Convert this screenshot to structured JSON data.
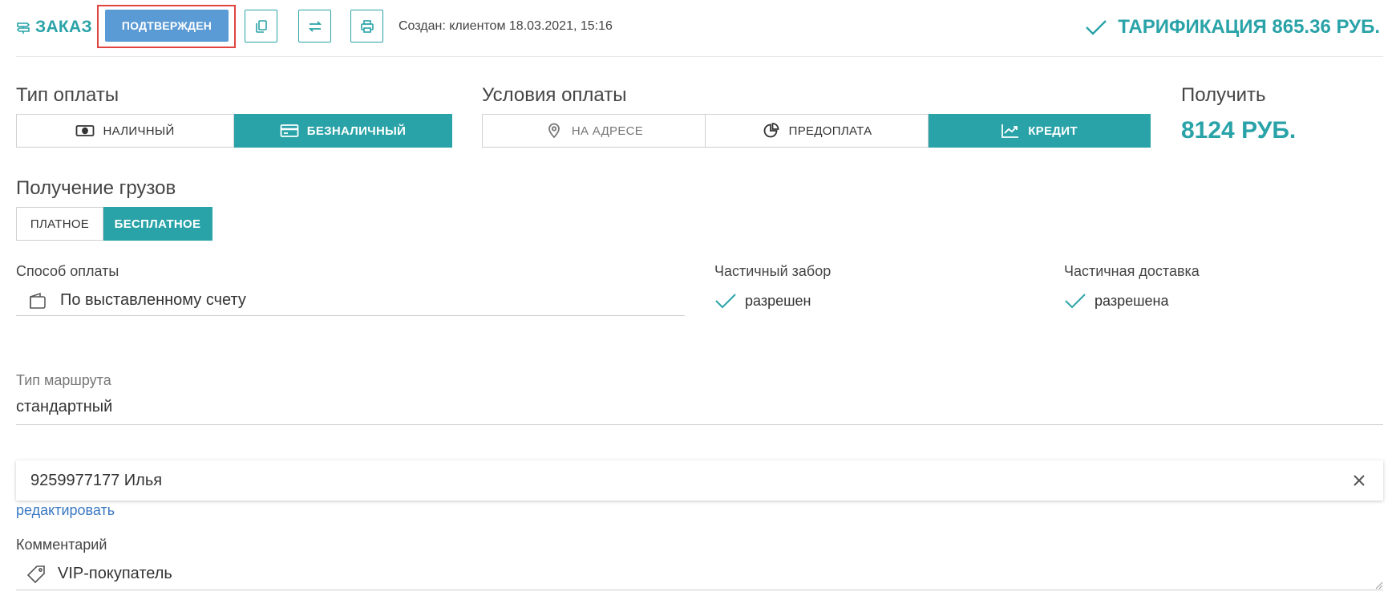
{
  "header": {
    "order_label": "ЗАКАЗ",
    "status_label": "ПОДТВЕРЖДЕН",
    "created_text": "Создан: клиентом 18.03.2021, 15:16",
    "tariff_text": "ТАРИФИКАЦИЯ 865.36 РУБ.",
    "actions": [
      {
        "icon": "copy-icon"
      },
      {
        "icon": "swap-icon"
      },
      {
        "icon": "print-icon"
      }
    ]
  },
  "payment_type": {
    "label": "Тип оплаты",
    "options": [
      {
        "label": "НАЛИЧНЫЙ",
        "icon": "cash-icon",
        "active": false
      },
      {
        "label": "БЕЗНАЛИЧНЫЙ",
        "icon": "card-icon",
        "active": true
      }
    ]
  },
  "payment_terms": {
    "label": "Условия оплаты",
    "options": [
      {
        "label": "НА АДРЕСЕ",
        "icon": "location-pin-icon",
        "active": false,
        "muted": true
      },
      {
        "label": "ПРЕДОПЛАТА",
        "icon": "pie-chart-icon",
        "active": false,
        "muted": false
      },
      {
        "label": "КРЕДИТ",
        "icon": "trend-chart-icon",
        "active": true,
        "muted": false
      }
    ]
  },
  "receive": {
    "label": "Получить",
    "amount": "8124 РУБ."
  },
  "cargo_receipt": {
    "label": "Получение грузов",
    "options": [
      {
        "label": "ПЛАТНОЕ",
        "active": false
      },
      {
        "label": "БЕСПЛАТНОЕ",
        "active": true
      }
    ]
  },
  "payment_method": {
    "label": "Способ оплаты",
    "value": "По выставленному счету",
    "icon": "wallet-icon"
  },
  "partial_pickup": {
    "label": "Частичный забор",
    "value": "разрешен"
  },
  "partial_delivery": {
    "label": "Частичная доставка",
    "value": "разрешена"
  },
  "route_type": {
    "label": "Тип маршрута",
    "value": "стандартный"
  },
  "contact": {
    "value": "9259977177 Илья",
    "edit_label": "редактировать"
  },
  "comment": {
    "label": "Комментарий",
    "value": "VIP-покупатель",
    "icon": "tag-icon"
  },
  "colors": {
    "accent": "#2aa3a8",
    "status_button": "#5b9bd5",
    "highlight_outline": "#e0443f",
    "link": "#3a78c2"
  }
}
